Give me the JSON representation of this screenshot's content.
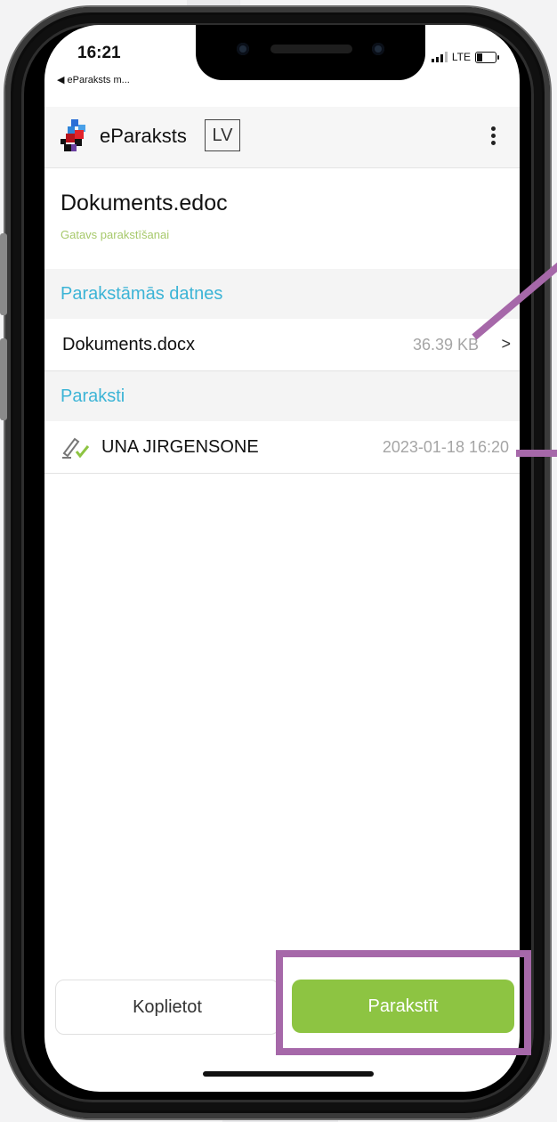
{
  "status_bar": {
    "time": "16:21",
    "back_label": "◀ eParaksts  m...",
    "network": "LTE"
  },
  "app_header": {
    "brand": "eParaksts",
    "country_code": "LV"
  },
  "document": {
    "title": "Dokuments.edoc",
    "status": "Gatavs parakstīšanai"
  },
  "files_section": {
    "heading": "Parakstāmās datnes",
    "items": [
      {
        "name": "Dokuments.docx",
        "size": "36.39 KB"
      }
    ]
  },
  "signatures_section": {
    "heading": "Paraksti",
    "items": [
      {
        "signer": "UNA JIRGENSONE",
        "timestamp": "2023-01-18 16:20"
      }
    ]
  },
  "actions": {
    "share_label": "Koplietot",
    "sign_label": "Parakstīt"
  },
  "colors": {
    "accent_blue": "#3cb4d6",
    "sign_green": "#8dc442",
    "annotation_purple": "#a668a9",
    "status_green": "#a7c96b"
  }
}
